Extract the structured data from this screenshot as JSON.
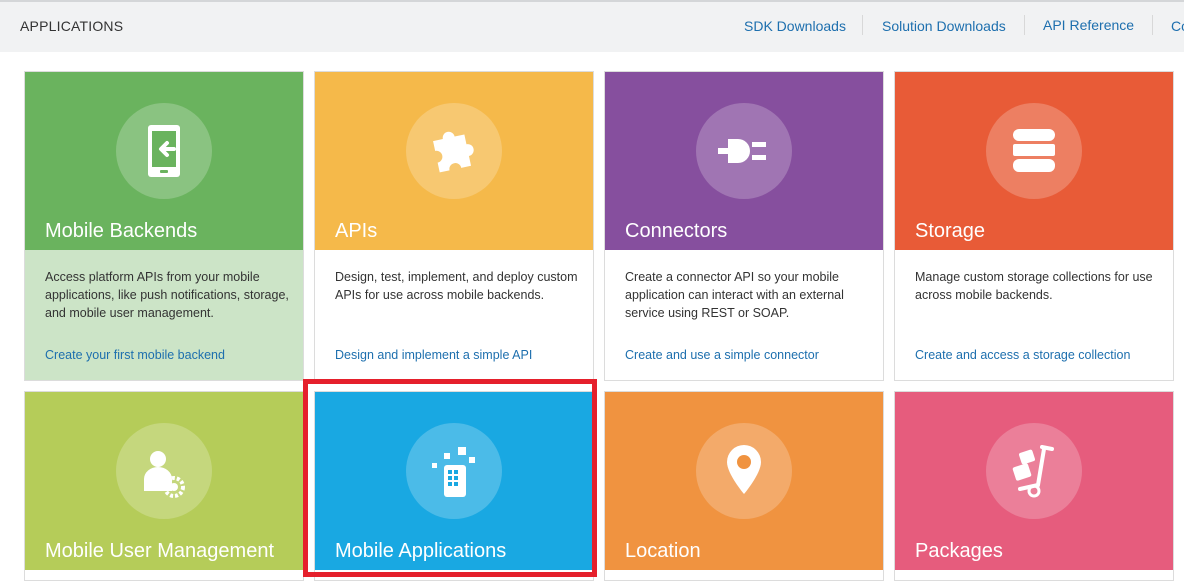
{
  "header": {
    "title": "APPLICATIONS",
    "links": [
      {
        "label": "SDK Downloads"
      },
      {
        "label": "Solution Downloads"
      },
      {
        "label": "API Reference"
      },
      {
        "label": "Co"
      }
    ]
  },
  "tiles": [
    {
      "title": "Mobile Backends",
      "icon": "mobile-login-icon",
      "color": "#6ab35e",
      "body_bg": "#cce4c7",
      "description": "Access platform APIs from your mobile applications, like push notifications, storage, and mobile user management.",
      "link": "Create your first mobile backend"
    },
    {
      "title": "APIs",
      "icon": "puzzle-piece-icon",
      "color": "#f5b94a",
      "body_bg": "#ffffff",
      "description": "Design, test, implement, and deploy custom APIs for use across mobile backends.",
      "link": "Design and implement a simple API"
    },
    {
      "title": "Connectors",
      "icon": "plug-icon",
      "color": "#864f9e",
      "body_bg": "#ffffff",
      "description": "Create a connector API so your mobile application can interact with an external service using REST or SOAP.",
      "link": "Create and use a simple connector"
    },
    {
      "title": "Storage",
      "icon": "database-icon",
      "color": "#e85b37",
      "body_bg": "#ffffff",
      "description": "Manage custom storage collections for use across mobile backends.",
      "link": "Create and access a storage collection"
    },
    {
      "title": "Mobile User Management",
      "icon": "user-settings-icon",
      "color": "#b5cc59",
      "body_bg": "#ffffff",
      "description": "",
      "link": ""
    },
    {
      "title": "Mobile Applications",
      "icon": "mobile-apps-icon",
      "color": "#19a8e2",
      "body_bg": "#ffffff",
      "description": "",
      "link": ""
    },
    {
      "title": "Location",
      "icon": "location-pin-icon",
      "color": "#f09340",
      "body_bg": "#ffffff",
      "description": "",
      "link": ""
    },
    {
      "title": "Packages",
      "icon": "hand-truck-icon",
      "color": "#e65c7d",
      "body_bg": "#ffffff",
      "description": "",
      "link": ""
    }
  ],
  "highlight_color": "#e5202c"
}
